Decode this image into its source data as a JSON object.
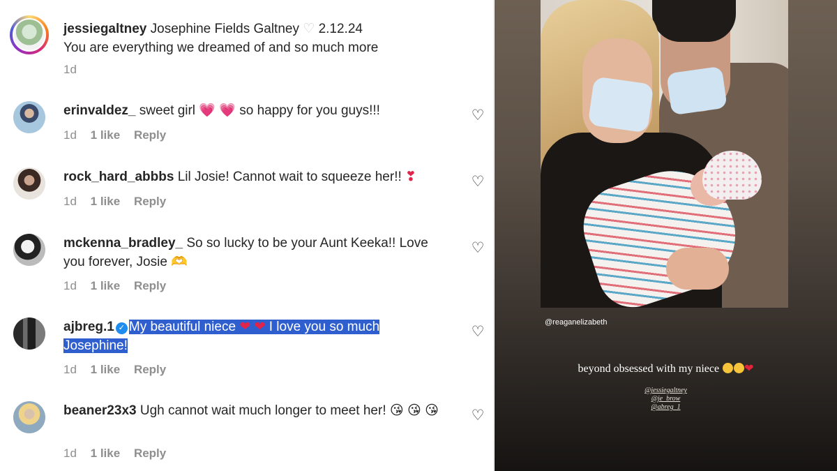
{
  "comments": [
    {
      "username": "jessiegaltney",
      "text_plain": "Josephine Fields Galtney",
      "heart": "♡",
      "date": "2.12.24",
      "line2": "You are everything we dreamed of and so much more",
      "time": "1d"
    },
    {
      "username": "erinvaldez_",
      "text_a": "sweet girl",
      "emoji_a": "💗",
      "emoji_b": "💗",
      "text_b": "so happy for you guys!!!",
      "time": "1d",
      "likes": "1 like",
      "reply": "Reply"
    },
    {
      "username": "rock_hard_abbbs",
      "text": "Lil Josie! Cannot wait to squeeze her!!",
      "emoji": "❣",
      "time": "1d",
      "likes": "1 like",
      "reply": "Reply"
    },
    {
      "username": "mckenna_bradley_",
      "text": "So so lucky to be your Aunt Keeka!! Love you forever, Josie",
      "emoji": "🫶",
      "time": "1d",
      "likes": "1 like",
      "reply": "Reply"
    },
    {
      "username": "ajbreg.1",
      "verified": "✓",
      "text_a": "My beautiful niece",
      "emoji_a": "❤",
      "emoji_b": "❤",
      "text_b": "I love you so much Josephine!",
      "time": "1d",
      "likes": "1 like",
      "reply": "Reply"
    },
    {
      "username": "beaner23x3",
      "text": "Ugh cannot wait much longer to meet her!",
      "emoji": "😘",
      "time": "1d",
      "likes": "1 like",
      "reply": "Reply"
    }
  ],
  "like_icon": "♡",
  "story": {
    "mention": "@reaganelizabeth",
    "caption": "beyond obsessed with my niece",
    "caption_heart": "❤",
    "tags": [
      "@jessiegaltney",
      "@je_brow",
      "@abreg_1"
    ]
  },
  "colors": {
    "highlight": "#2f5fcf",
    "meta": "#8e8e8e",
    "verified": "#1f8cf0"
  }
}
